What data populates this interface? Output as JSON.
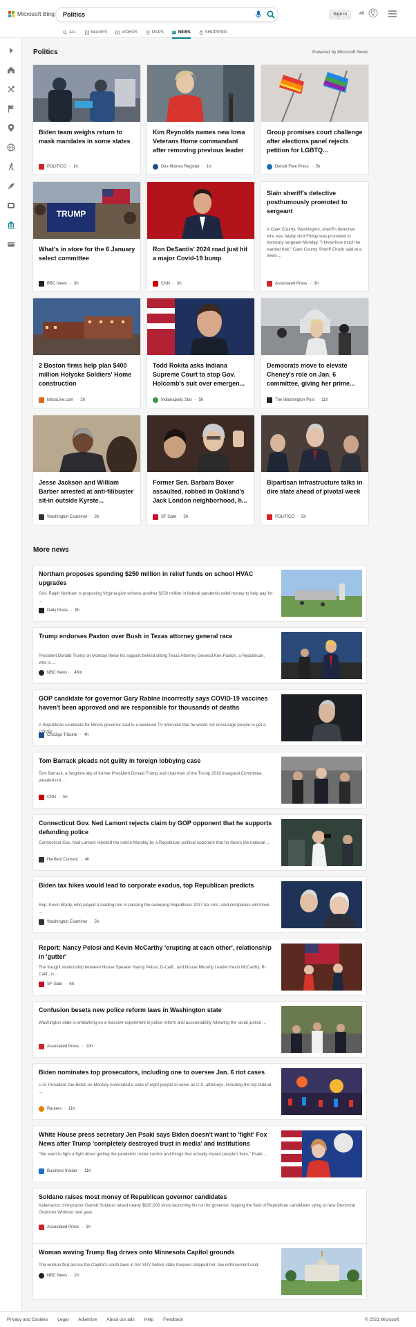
{
  "brand": {
    "name": "Microsoft Bing",
    "colors": [
      "#f25022",
      "#7fba00",
      "#00a4ef",
      "#ffb900"
    ]
  },
  "search": {
    "value": "Politics"
  },
  "header": {
    "signin_label": "Sign in",
    "rewards_count": "40"
  },
  "tabs": [
    {
      "label": "ALL",
      "icon": "search-icon"
    },
    {
      "label": "IMAGES",
      "icon": "image-icon"
    },
    {
      "label": "VIDEOS",
      "icon": "video-icon"
    },
    {
      "label": "MAPS",
      "icon": "map-pin-icon"
    },
    {
      "label": "NEWS",
      "icon": "news-icon",
      "active": true
    },
    {
      "label": "SHOPPING",
      "icon": "shopping-icon"
    }
  ],
  "accent_color": "#067d8f",
  "section": {
    "title": "Politics",
    "powered": "Powered by Microsoft News"
  },
  "cards": [
    {
      "title": "Biden team weighs return to mask mandates in some states",
      "source": "POLITICO",
      "time": "1h",
      "src_color": "#d2232a"
    },
    {
      "title": "Kim Reynolds names new Iowa Veterans Home commandant after removing previous leader",
      "source": "Des Moines Register",
      "time": "1h",
      "src_color": "#1d4e89"
    },
    {
      "title": "Group promises court challenge after elections panel rejects petition for LGBTQ...",
      "source": "Detroit Free Press",
      "time": "5h",
      "src_color": "#1a6fb5"
    },
    {
      "title": "What's in store for the 6 January select committee",
      "source": "BBC News",
      "time": "3h",
      "src_color": "#222222"
    },
    {
      "title": "Ron DeSantis' 2024 road just hit a major Covid-19 bump",
      "source": "CNN",
      "time": "3h",
      "src_color": "#cc0000"
    },
    {
      "title": "Slain sheriff's detective posthumously promoted to sergeant",
      "snippet": "A Clark County, Washington, sheriff's detective who was fatally shot Friday was promoted to honorary sergeant Monday. \"I know how much he wanted that,\" Clark County Sheriff Chuck said at a news ...",
      "source": "Associated Press",
      "time": "3h",
      "src_color": "#d2232a"
    },
    {
      "title": "2 Boston firms help plan $400 million Holyoke Soldiers' Home construction",
      "source": "MassLive.com",
      "time": "2h",
      "src_color": "#e06a1b"
    },
    {
      "title": "Todd Rokita asks Indiana Supreme Court to stop Gov. Holcomb's suit over emergen...",
      "source": "Indianapolis Star",
      "time": "5h",
      "src_color": "#3a9a3a"
    },
    {
      "title": "Democrats move to elevate Cheney's role on Jan. 6 committee, giving her prime...",
      "source": "The Washington Post",
      "time": "11h",
      "src_color": "#222222"
    },
    {
      "title": "Jesse Jackson and William Barber arrested at anti-filibuster sit-in outside Kyrste...",
      "source": "Washington Examiner",
      "time": "3h",
      "src_color": "#333333"
    },
    {
      "title": "Former Sen. Barbara Boxer assaulted, robbed in Oakland's Jack London neighborhood, h...",
      "source": "SF Gate",
      "time": "3h",
      "src_color": "#c8102e"
    },
    {
      "title": "Bipartisan infrastructure talks in dire state ahead of pivotal week",
      "source": "POLITICO",
      "time": "5h",
      "src_color": "#d2232a"
    }
  ],
  "more_news": {
    "title": "More news",
    "items": [
      {
        "title": "Northam proposes spending $250 million in relief funds on school HVAC upgrades",
        "snippet": "Gov. Ralph Northam is proposing Virginia give schools another $250 million in federal pandemic relief money to help pay for ...",
        "source": "Daily Press",
        "time": "9h",
        "src_color": "#222222"
      },
      {
        "title": "Trump endorses Paxton over Bush in Texas attorney general race",
        "snippet": "President Donald Trump on Monday threw his support behind sitting Texas Attorney General Ken Paxton, a Republican, who is ...",
        "source": "NBC News",
        "time": "46m",
        "src_color": "#222222"
      },
      {
        "title": "GOP candidate for governor Gary Rabine incorrectly says COVID-19 vaccines haven't been approved and are responsible for thousands of deaths",
        "snippet": "A Republican candidate for Illinois governor said in a weekend TV interview that he would not encourage people to get a COVID ...",
        "source": "Chicago Tribune",
        "time": "4h",
        "src_color": "#1d4e89"
      },
      {
        "title": "Tom Barrack pleads not guilty in foreign lobbying case",
        "snippet": "Tom Barrack, a longtime ally of former President Donald Trump and chairman of the Trump 2016 inaugural Committee, pleaded not ...",
        "source": "CNN",
        "time": "5h",
        "src_color": "#cc0000"
      },
      {
        "title": "Connecticut Gov. Ned Lamont rejects claim by GOP opponent that he supports defunding police",
        "snippet": "Connecticut Gov. Ned Lamont rejected the notion Monday by a Republican political opponent that he favors the national ...",
        "source": "Hartford Courant",
        "time": "4h",
        "src_color": "#333333"
      },
      {
        "title": "Biden tax hikes would lead to corporate exodus, top Republican predicts",
        "snippet": "Rep. Kevin Brady, who played a leading role in passing the sweeping Republican 2017 tax cuts, said companies will move ...",
        "source": "Washington Examiner",
        "time": "5h",
        "src_color": "#333333"
      },
      {
        "title": "Report: Nancy Pelosi and Kevin McCarthy 'erupting at each other', relationship in 'gutter'",
        "snippet": "The fraught relationship between House Speaker Nancy Pelosi, D-Calif., and House Minority Leader Kevin McCarthy, R-Calif., is ...",
        "source": "SF Gate",
        "time": "6h",
        "src_color": "#c8102e"
      },
      {
        "title": "Confusion besets new police reform laws in Washington state",
        "snippet": "Washington state is embarking on a massive experiment in police reform and accountability following the racial justice ...",
        "source": "Associated Press",
        "time": "10h",
        "src_color": "#d2232a"
      },
      {
        "title": "Biden nominates top prosecutors, including one to oversee Jan. 6 riot cases",
        "snippet": "U.S. President Joe Biden on Monday nominated a slate of eight people to serve as U.S. attorneys, including the top federal ...",
        "source": "Reuters",
        "time": "11h",
        "src_color": "#f07d00"
      },
      {
        "title": "White House press secretary Jen Psaki says Biden doesn't want to 'fight' Fox News after Trump 'completely destroyed trust in media' and institutions",
        "snippet": "\"We want to fight a fight about getting the pandemic under control and things that actually impact people's lives,\" Psaki ...",
        "source": "Business Insider",
        "time": "11h",
        "src_color": "#1f6fd1"
      },
      {
        "title": "Soldano raises most money of Republican governor candidates",
        "snippet": "Kalamazoo chiropractor Garrett Soldano raised nearly $625,000 since launching his run for governor, topping the field of Republican candidates vying to face Democrat Gretchen Whitmer next year.",
        "source": "Associated Press",
        "time": "1h",
        "src_color": "#d2232a"
      },
      {
        "title": "Woman waving Trump flag drives onto Minnesota Capitol grounds",
        "snippet": "The woman fled across the Capitol's south lawn in her SUV before state troopers stopped her, law enforcement said.",
        "source": "NBC News",
        "time": "2h",
        "src_color": "#222222"
      }
    ]
  },
  "footer": {
    "links": [
      "Privacy and Cookies",
      "Legal",
      "Advertise",
      "About our ads",
      "Help",
      "Feedback"
    ],
    "copyright": "© 2021 Microsoft"
  }
}
